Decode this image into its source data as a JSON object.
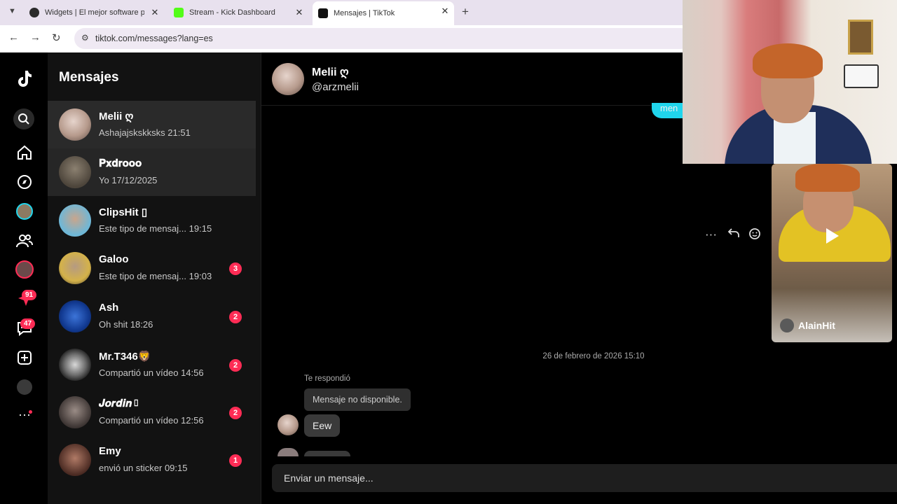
{
  "browser": {
    "tabs": [
      {
        "title": "Widgets | El mejor software pa",
        "fav_color": "#2b2b2b"
      },
      {
        "title": "Stream - Kick Dashboard",
        "fav_color": "#53fc18"
      },
      {
        "title": "Mensajes | TikTok",
        "fav_color": "#111111"
      }
    ],
    "new_tab": "+",
    "url": "tiktok.com/messages?lang=es"
  },
  "rail": {
    "notif_count": "91",
    "inbox_count": "47"
  },
  "list": {
    "title": "Mensajes",
    "conversations": [
      {
        "name": "Melii ღ",
        "preview": "Ashajajskskksks",
        "time": "21:51",
        "unread": "",
        "selected": true
      },
      {
        "name": "𝐏𝐱𝐝𝐫𝐨𝐨𝐨",
        "preview": "Yo",
        "time": "17/12/2025",
        "unread": "",
        "selected": true
      },
      {
        "name": "ClipsHit ▯",
        "preview": "Este tipo de mensaj...",
        "time": "19:15",
        "unread": ""
      },
      {
        "name": "Galoo",
        "preview": "Este tipo de mensaj...",
        "time": "19:03",
        "unread": "3"
      },
      {
        "name": "Ash",
        "preview": "Oh shit",
        "time": "18:26",
        "unread": "2"
      },
      {
        "name": "Mr.T346🦁",
        "preview": "Compartió un vídeo",
        "time": "14:56",
        "unread": "2"
      },
      {
        "name": "𝑱𝒐𝒓𝒅𝒊𝒏▯",
        "preview": "Compartió un vídeo",
        "time": "12:56",
        "unread": "2"
      },
      {
        "name": "Emy",
        "preview": "envió un sticker",
        "time": "09:15",
        "unread": "1"
      }
    ]
  },
  "chat": {
    "name": "Melii ღ",
    "handle": "@arzmelii",
    "top_bubble": "men",
    "date": "26 de febrero de 2026 15:10",
    "replied_label": "Te respondió",
    "unavailable": "Mensaje no disponible.",
    "last_message": "Eew",
    "input_placeholder": "Enviar un mensaje..."
  },
  "overlay": {
    "clip_user": "AlainHit"
  }
}
